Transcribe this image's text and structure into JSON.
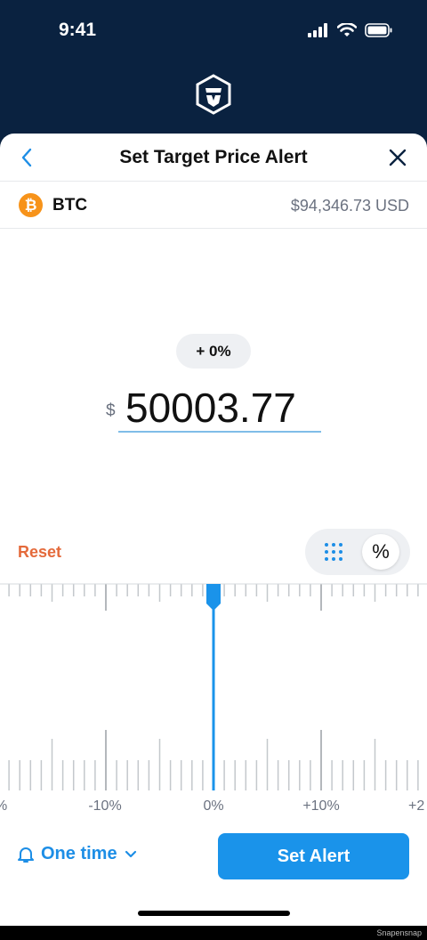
{
  "status_bar": {
    "time": "9:41"
  },
  "header": {
    "title": "Set Target Price Alert",
    "logo_icon": "crypto-lion-shield-icon"
  },
  "asset": {
    "symbol": "BTC",
    "current_price": "$94,346.73 USD",
    "icon_glyph": "₿",
    "icon_color": "#f7931a"
  },
  "target": {
    "percent_change": "+ 0%",
    "currency_symbol": "$",
    "price_value": "50003.77"
  },
  "controls": {
    "reset_label": "Reset",
    "percent_toggle_label": "%"
  },
  "ruler": {
    "tick_labels": [
      "%",
      "-10%",
      "0%",
      "+10%",
      "+2"
    ],
    "selected_percent": 0
  },
  "footer": {
    "frequency_label": "One time",
    "submit_label": "Set Alert"
  },
  "watermark": "Snapensnap",
  "colors": {
    "header_bg": "#0a2240",
    "accent": "#1a93ea",
    "reset": "#e46a3b"
  }
}
